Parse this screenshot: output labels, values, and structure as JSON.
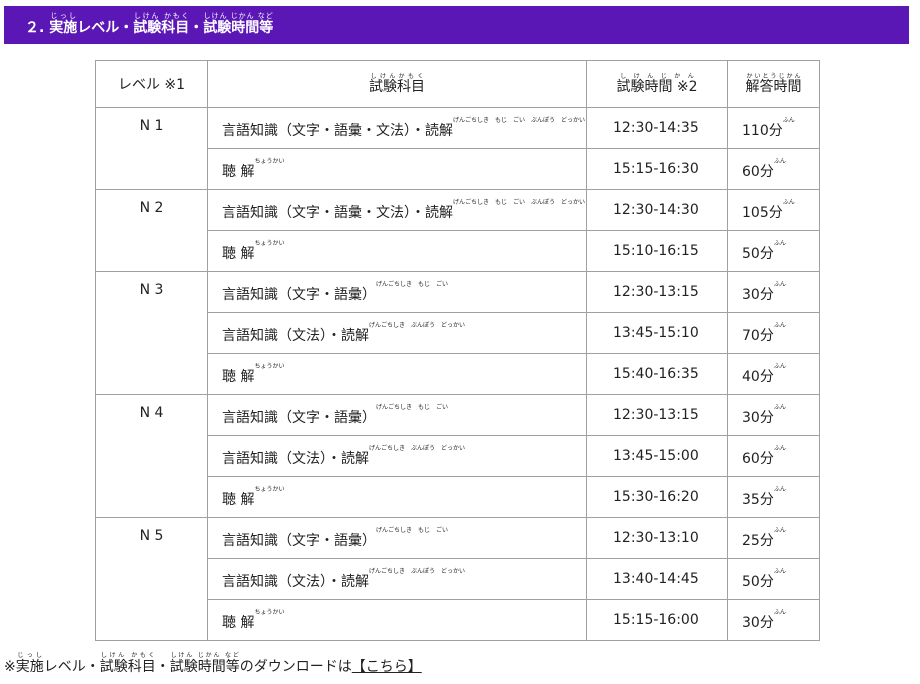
{
  "header": {
    "number": "２.",
    "parts": [
      {
        "text": "実施",
        "ruby": "じっし"
      },
      {
        "text": "レベル・"
      },
      {
        "text": "試験科目",
        "ruby": "しけん かもく"
      },
      {
        "text": "・"
      },
      {
        "text": "試験時間等",
        "ruby": "しけん じかん など"
      }
    ]
  },
  "table": {
    "headers": {
      "level": "レベル ※1",
      "subject": {
        "text": "試験科目",
        "ruby": "しけんかもく"
      },
      "time": {
        "text": "試験時間 ※2",
        "ruby": "しけんじかん"
      },
      "duration": {
        "text": "解答時間",
        "ruby": "かいとうじかん"
      }
    },
    "groups": [
      {
        "level": "N 1",
        "rows": [
          {
            "subject": "言語知識（文字・語彙・文法）・読解",
            "ruby": "げんごちしき　もじ　ごい　ぶんぽう　どっかい",
            "time": "12:30-14:35",
            "duration": "110分",
            "dur_ruby": "ふん"
          },
          {
            "subject": "聴 解",
            "ruby": "ちょうかい",
            "time": "15:15-16:30",
            "duration": "60分",
            "dur_ruby": "ふん"
          }
        ]
      },
      {
        "level": "N 2",
        "rows": [
          {
            "subject": "言語知識（文字・語彙・文法）・読解",
            "ruby": "げんごちしき　もじ　ごい　ぶんぽう　どっかい",
            "time": "12:30-14:30",
            "duration": "105分",
            "dur_ruby": "ふん"
          },
          {
            "subject": "聴 解",
            "ruby": "ちょうかい",
            "time": "15:10-16:15",
            "duration": "50分",
            "dur_ruby": "ふん"
          }
        ]
      },
      {
        "level": "N 3",
        "rows": [
          {
            "subject": "言語知識（文字・語彙）",
            "ruby": "げんごちしき　もじ　ごい",
            "time": "12:30-13:15",
            "duration": "30分",
            "dur_ruby": "ふん"
          },
          {
            "subject": "言語知識（文法）・読解",
            "ruby": "げんごちしき　ぶんぽう　どっかい",
            "time": "13:45-15:10",
            "duration": "70分",
            "dur_ruby": "ふん"
          },
          {
            "subject": "聴 解",
            "ruby": "ちょうかい",
            "time": "15:40-16:35",
            "duration": "40分",
            "dur_ruby": "ふん"
          }
        ]
      },
      {
        "level": "N 4",
        "rows": [
          {
            "subject": "言語知識（文字・語彙）",
            "ruby": "げんごちしき　もじ　ごい",
            "time": "12:30-13:15",
            "duration": "30分",
            "dur_ruby": "ふん"
          },
          {
            "subject": "言語知識（文法）・読解",
            "ruby": "げんごちしき　ぶんぽう　どっかい",
            "time": "13:45-15:00",
            "duration": "60分",
            "dur_ruby": "ふん"
          },
          {
            "subject": "聴 解",
            "ruby": "ちょうかい",
            "time": "15:30-16:20",
            "duration": "35分",
            "dur_ruby": "ふん"
          }
        ]
      },
      {
        "level": "N 5",
        "rows": [
          {
            "subject": "言語知識（文字・語彙）",
            "ruby": "げんごちしき　もじ　ごい",
            "time": "12:30-13:10",
            "duration": "25分",
            "dur_ruby": "ふん"
          },
          {
            "subject": "言語知識（文法）・読解",
            "ruby": "げんごちしき　ぶんぽう　どっかい",
            "time": "13:40-14:45",
            "duration": "50分",
            "dur_ruby": "ふん"
          },
          {
            "subject": "聴 解",
            "ruby": "ちょうかい",
            "time": "15:15-16:00",
            "duration": "30分",
            "dur_ruby": "ふん"
          }
        ]
      }
    ]
  },
  "note": {
    "prefix": "※",
    "parts": [
      {
        "text": "実施",
        "ruby": "じっし"
      },
      {
        "text": "レベル・"
      },
      {
        "text": "試験科目",
        "ruby": "しけん かもく"
      },
      {
        "text": "・"
      },
      {
        "text": "試験時間等",
        "ruby": "しけん じかん など"
      },
      {
        "text": "のダウンロードは"
      }
    ],
    "link": "【こちら】"
  },
  "colors": {
    "header_bg": "#5b17b5",
    "header_text": "#ffffff",
    "border": "#a0a0a0"
  }
}
